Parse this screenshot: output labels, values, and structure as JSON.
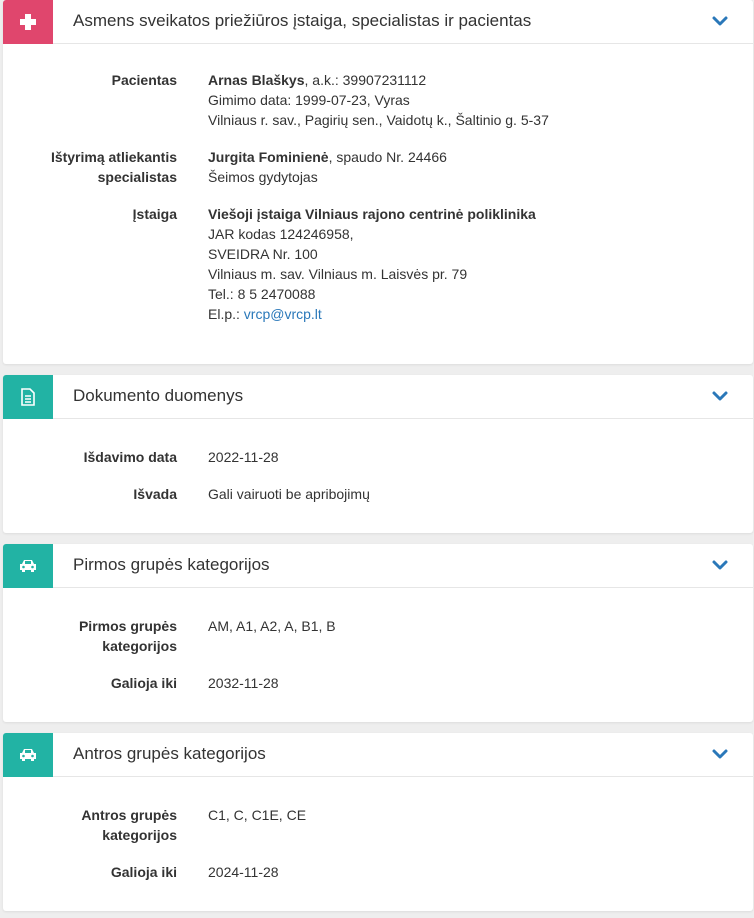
{
  "colors": {
    "pink": "#e0466d",
    "teal": "#22b3a4",
    "chevron": "#2a78b9"
  },
  "panels": {
    "health": {
      "icon": "medical-cross-icon",
      "title": "Asmens sveikatos priežiūros įstaiga, specialistas ir pacientas",
      "patient": {
        "label": "Pacientas",
        "name": "Arnas Blaškys",
        "code": ", a.k.: 39907231112",
        "birth": "Gimimo data: 1999-07-23, Vyras",
        "address": "Vilniaus r. sav., Pagirių sen., Vaidotų k., Šaltinio g. 5-37"
      },
      "specialist": {
        "label_line1": "Ištyrimą atliekantis",
        "label_line2": "specialistas",
        "name": "Jurgita Fominienė",
        "stamp": ", spaudo Nr. 24466",
        "role": "Šeimos gydytojas"
      },
      "institution": {
        "label": "Įstaiga",
        "name": "Viešoji įstaiga Vilniaus rajono centrinė poliklinika",
        "jar": "JAR kodas 124246958,",
        "sveidra": "SVEIDRA Nr. 100",
        "address": "Vilniaus m. sav. Vilniaus m. Laisvės pr. 79",
        "phone": "Tel.: 8 5 2470088",
        "email_prefix": "El.p.: ",
        "email": "vrcp@vrcp.lt"
      }
    },
    "document": {
      "icon": "document-icon",
      "title": "Dokumento duomenys",
      "issue_label": "Išdavimo data",
      "issue_value": "2022-11-28",
      "conclusion_label": "Išvada",
      "conclusion_value": "Gali vairuoti be apribojimų"
    },
    "group1": {
      "icon": "car-icon",
      "title": "Pirmos grupės kategorijos",
      "cat_label_line1": "Pirmos grupės",
      "cat_label_line2": "kategorijos",
      "cat_value": "AM, A1, A2, A, B1, B",
      "valid_label": "Galioja iki",
      "valid_value": "2032-11-28"
    },
    "group2": {
      "icon": "car-icon",
      "title": "Antros grupės kategorijos",
      "cat_label_line1": "Antros grupės",
      "cat_label_line2": "kategorijos",
      "cat_value": "C1, C, C1E, CE",
      "valid_label": "Galioja iki",
      "valid_value": "2024-11-28"
    }
  }
}
